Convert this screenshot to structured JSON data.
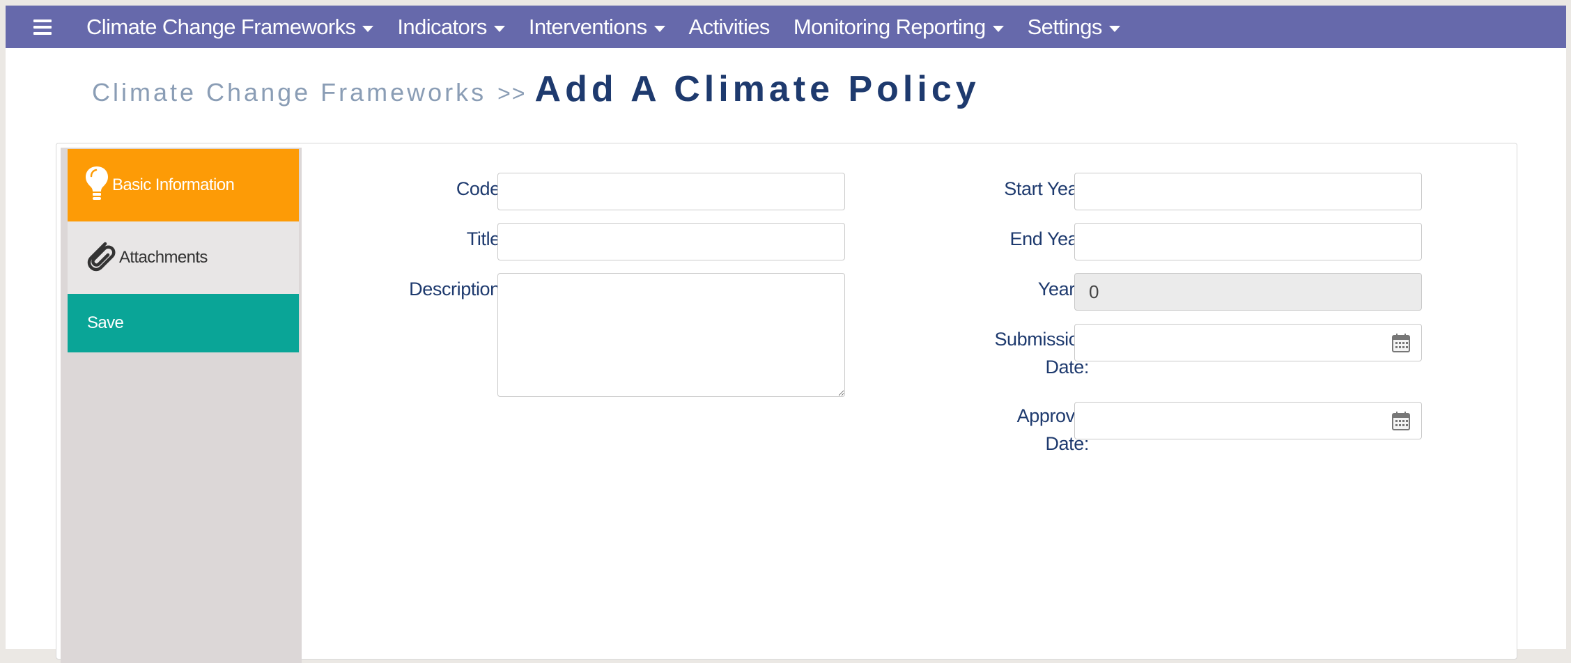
{
  "nav": {
    "items": [
      {
        "label": "Climate Change Frameworks",
        "dropdown": true
      },
      {
        "label": "Indicators",
        "dropdown": true
      },
      {
        "label": "Interventions",
        "dropdown": true
      },
      {
        "label": "Activities",
        "dropdown": false
      },
      {
        "label": "Monitoring Reporting",
        "dropdown": true
      },
      {
        "label": "Settings",
        "dropdown": true
      }
    ]
  },
  "breadcrumb": {
    "parent": "Climate Change Frameworks",
    "separator": ">>",
    "title": "Add A Climate Policy"
  },
  "sidebar": {
    "items": [
      {
        "label": "Basic Information",
        "icon": "lightbulb-icon",
        "active": true
      },
      {
        "label": "Attachments",
        "icon": "paperclip-icon",
        "active": false
      },
      {
        "label": "Save",
        "icon": "",
        "active": false
      }
    ]
  },
  "form": {
    "code": {
      "label": "Code:",
      "required_mark": "*",
      "value": ""
    },
    "title": {
      "label": "Title:",
      "required_mark": "*",
      "value": ""
    },
    "description": {
      "label": "Description:",
      "required_mark": "*",
      "value": ""
    },
    "start_year": {
      "label": "Start Year:",
      "value": ""
    },
    "end_year": {
      "label": "End Year:",
      "value": ""
    },
    "years": {
      "label": "Years:",
      "value": "0"
    },
    "submission_date": {
      "label_line1": "Submission",
      "label_line2": "Date:",
      "value": ""
    },
    "approval_date": {
      "label_line1": "Approval",
      "label_line2": "Date:",
      "value": ""
    }
  },
  "colors": {
    "navbar": "#6669ab",
    "title": "#1e3a6e",
    "active_tab": "#fd9b06",
    "save": "#0aa597",
    "required": "#d32f2f"
  }
}
